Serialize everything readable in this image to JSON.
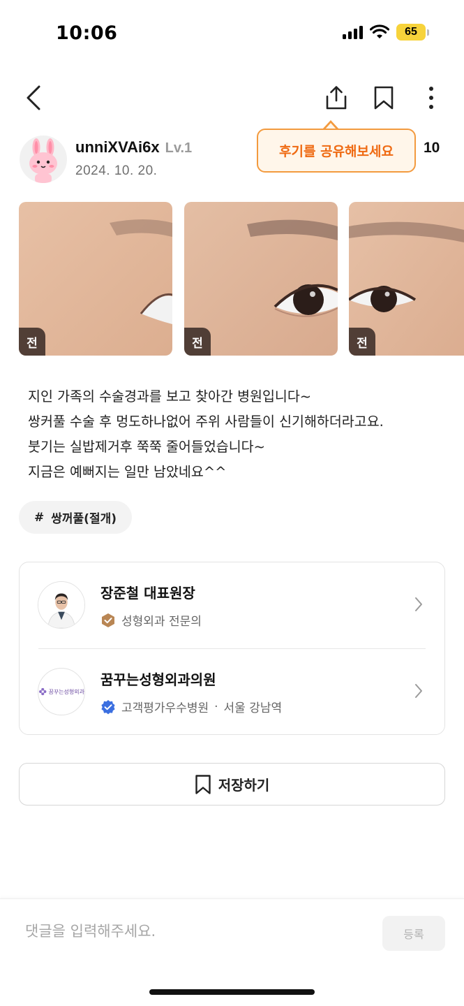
{
  "status_bar": {
    "time": "10:06",
    "battery": "65",
    "icons": [
      "signal-icon",
      "wifi-icon",
      "battery-icon"
    ]
  },
  "nav": {
    "icons": [
      "back-icon",
      "share-icon",
      "bookmark-icon",
      "more-icon"
    ]
  },
  "author": {
    "name": "unniXVAi6x",
    "level": "Lv.1",
    "date": "2024. 10. 20."
  },
  "tooltip": {
    "text": "후기를 공유해보세요"
  },
  "view_count": "10",
  "photos": [
    {
      "badge": "전"
    },
    {
      "badge": "전"
    },
    {
      "badge": "전"
    }
  ],
  "review": {
    "lines": [
      "지인 가족의 수술경과를 보고 찾아간 병원입니다~",
      "쌍커풀  수술 후 멍도하나없어 주위 사람들이 신기해하더라고요.",
      "붓기는 실밥제거후 쭉쭉 줄어들었습니다~",
      "지금은 예뻐지는 일만 남았네요^^"
    ]
  },
  "tag": {
    "hash": "#",
    "label": "쌍꺼풀(절개)"
  },
  "doctor": {
    "name": "장준철 대표원장",
    "specialty": "성형외과 전문의"
  },
  "clinic": {
    "name": "꿈꾸는성형외과의원",
    "logo_text": "꿈꾸는성형외과",
    "badge": "고객평가우수병원",
    "separator": "·",
    "location": "서울 강남역"
  },
  "save": {
    "label": "저장하기"
  },
  "comment": {
    "placeholder": "댓글을 입력해주세요.",
    "value": "",
    "submit_label": "등록"
  },
  "colors": {
    "accent_orange": "#ef6a12",
    "tooltip_bg": "#fff6ea",
    "verified_blue": "#3b6fe0",
    "specialist_badge": "#b98654",
    "battery": "#f7d33b"
  }
}
